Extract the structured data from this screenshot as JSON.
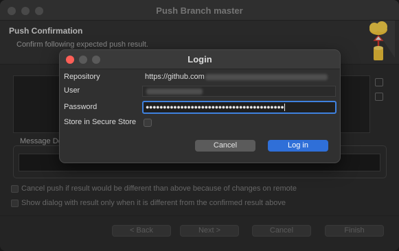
{
  "window": {
    "title": "Push Branch master"
  },
  "header": {
    "title": "Push Confirmation",
    "subtitle": "Confirm following expected push result."
  },
  "message_label": "Message De",
  "options": [
    {
      "label": "Cancel push if result would be different than above because of changes on remote",
      "checked": false
    },
    {
      "label": "Show dialog with result only when it is different from the confirmed result above",
      "checked": false
    }
  ],
  "footer_buttons": {
    "back": "< Back",
    "next": "Next >",
    "cancel": "Cancel",
    "finish": "Finish"
  },
  "login": {
    "title": "Login",
    "repository_label": "Repository",
    "repository_value": "https://github.com",
    "user_label": "User",
    "password_label": "Password",
    "password_mask": "●●●●●●●●●●●●●●●●●●●●●●●●●●●●●●●●●●●●●●●●",
    "store_label": "Store in Secure Store",
    "store_checked": false,
    "cancel_label": "Cancel",
    "login_label": "Log in"
  },
  "colors": {
    "accent_blue": "#2f6fd8",
    "focus_ring": "#3f82e0",
    "traffic_red": "#ff5f57",
    "traffic_inactive": "#5a5a5a"
  },
  "icons": {
    "banner": "cloud-upload-database-icon",
    "side_top": "collapse-icon",
    "side_bottom": "expand-icon"
  }
}
